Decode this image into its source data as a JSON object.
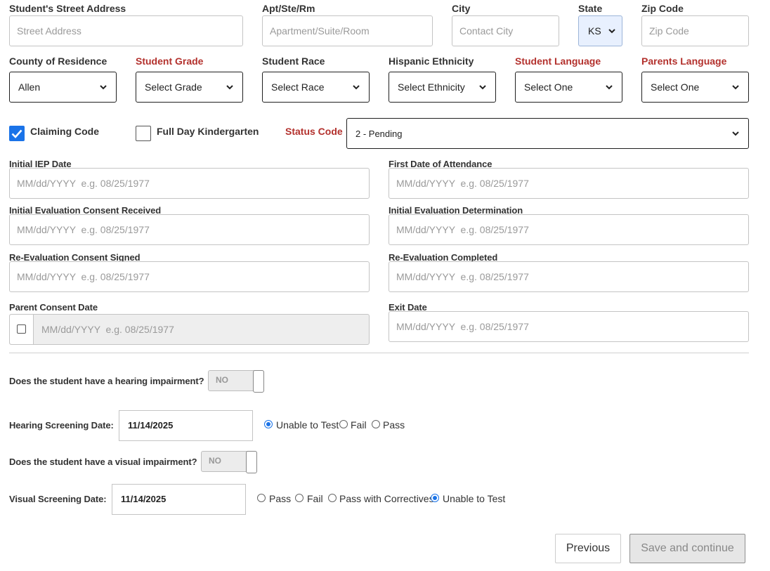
{
  "address": {
    "street_label": "Student's Street Address",
    "street_placeholder": "Street Address",
    "apt_label": "Apt/Ste/Rm",
    "apt_placeholder": "Apartment/Suite/Room",
    "city_label": "City",
    "city_placeholder": "Contact City",
    "state_label": "State",
    "state_value": "KS",
    "zip_label": "Zip Code",
    "zip_placeholder": "Zip Code"
  },
  "demographics": {
    "county_label": "County of Residence",
    "county_value": "Allen",
    "grade_label": "Student Grade",
    "grade_value": "Select Grade",
    "race_label": "Student Race",
    "race_value": "Select Race",
    "ethnicity_label": "Hispanic Ethnicity",
    "ethnicity_value": "Select Ethnicity",
    "student_language_label": "Student Language",
    "student_language_value": "Select One",
    "parents_language_label": "Parents Language",
    "parents_language_value": "Select One"
  },
  "flags": {
    "claiming_code_label": "Claiming Code",
    "claiming_code_checked": true,
    "full_day_k_label": "Full Day Kindergarten",
    "full_day_k_checked": false,
    "status_code_label": "Status Code",
    "status_code_value": "2 - Pending"
  },
  "dates": {
    "placeholder": "MM/dd/YYYY  e.g. 08/25/1977",
    "initial_iep_label": "Initial IEP Date",
    "first_attendance_label": "First Date of Attendance",
    "eval_consent_label": "Initial Evaluation Consent Received",
    "eval_determination_label": "Initial Evaluation Determination",
    "reeval_consent_label": "Re-Evaluation Consent Signed",
    "reeval_completed_label": "Re-Evaluation Completed",
    "parent_consent_label": "Parent Consent Date",
    "exit_date_label": "Exit Date"
  },
  "screening": {
    "hearing_question": "Does the student have a hearing impairment?",
    "hearing_toggle": "NO",
    "hearing_date_label": "Hearing Screening Date:",
    "hearing_date_value": "11/14/2025",
    "hearing_options": [
      "Unable to Test",
      "Fail",
      "Pass"
    ],
    "hearing_selected": "Unable to Test",
    "visual_question": "Does the student have a visual impairment?",
    "visual_toggle": "NO",
    "visual_date_label": "Visual Screening Date:",
    "visual_date_value": "11/14/2025",
    "visual_options": [
      "Pass",
      "Fail",
      "Pass with Correctives",
      "Unable to Test"
    ],
    "visual_selected": "Unable to Test"
  },
  "buttons": {
    "previous": "Previous",
    "save_continue": "Save and continue"
  },
  "colors": {
    "required_label": "#b3312d",
    "accent": "#1a73e8",
    "checkbox_checked": "#1a73e8"
  }
}
